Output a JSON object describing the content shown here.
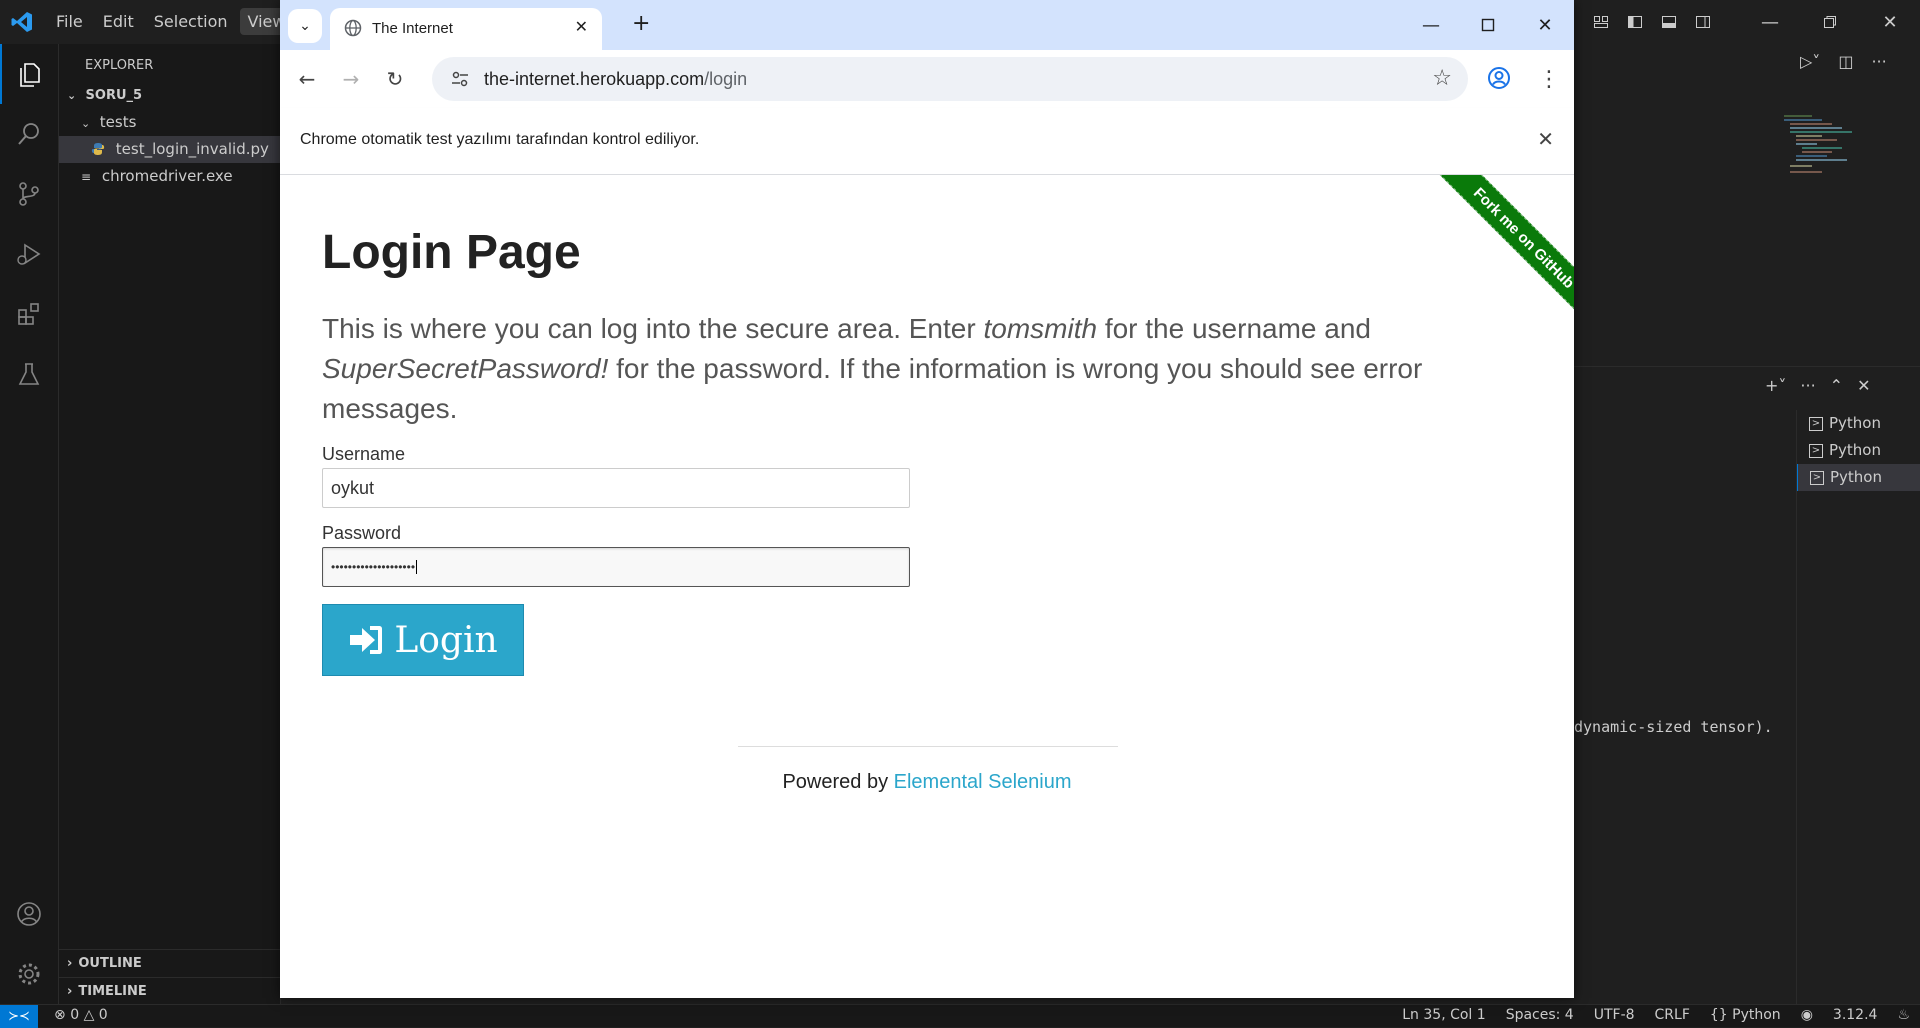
{
  "vscode": {
    "menu": [
      "File",
      "Edit",
      "Selection",
      "View"
    ],
    "explorer_title": "EXPLORER",
    "project": "SORU_5",
    "tree": {
      "folder": "tests",
      "file_selected": "test_login_invalid.py",
      "file_other": "chromedriver.exe"
    },
    "outline": "OUTLINE",
    "timeline": "TIMELINE",
    "terminals": [
      "Python",
      "Python",
      "Python"
    ],
    "terminal_text": "dynamic-sized tensor).",
    "status": {
      "errors": "0",
      "warnings": "0",
      "position": "Ln 35, Col 1",
      "spaces": "Spaces: 4",
      "encoding": "UTF-8",
      "eol": "CRLF",
      "language": "{} Python",
      "version": "3.12.4"
    }
  },
  "chrome": {
    "tab_title": "The Internet",
    "url_host": "the-internet.herokuapp.com",
    "url_path": "/login",
    "infobar": "Chrome otomatik test yazılımı tarafından kontrol ediliyor."
  },
  "page": {
    "ribbon": "Fork me on GitHub",
    "title": "Login Page",
    "lead_1": "This is where you can log into the secure area. Enter ",
    "lead_user": "tomsmith",
    "lead_2": " for the username and ",
    "lead_pass": "SuperSecretPassword!",
    "lead_3": " for the password. If the information is wrong you should see error messages.",
    "username_label": "Username",
    "username_value": "oykut",
    "password_label": "Password",
    "password_mask": "••••••••••••••••••••",
    "login_label": "Login",
    "footer_prefix": "Powered by ",
    "footer_link": "Elemental Selenium"
  },
  "colors": {
    "vscode_bg": "#1f1f1f",
    "accent_blue": "#0078d4",
    "chrome_tabstrip": "#d3e3fd",
    "login_button": "#2ba6cb",
    "ribbon_green": "#0a7a0a"
  }
}
